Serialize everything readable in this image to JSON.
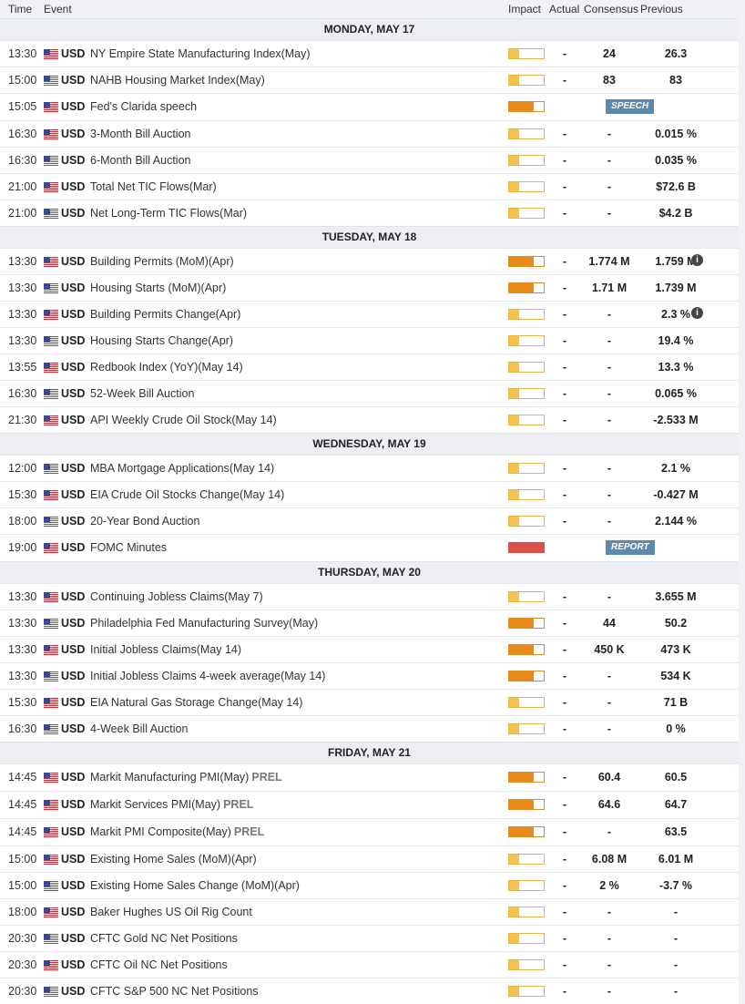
{
  "header": {
    "time_label": "Time",
    "event_label": "Event",
    "impact_label": "Impact",
    "actual_label": "Actual",
    "consensus_label": "Consensus",
    "previous_label": "Previous"
  },
  "colors": {
    "low_impact": "#f6c248",
    "medium_impact": "#e88a17",
    "high_impact": "#d9514a",
    "badge": "#5f88ad"
  },
  "days": [
    {
      "label": "MONDAY, MAY 17",
      "events": [
        {
          "time": "13:30",
          "currency": "USD",
          "event": "NY Empire State Manufacturing Index(May)",
          "impact": "low",
          "actual": "-",
          "consensus": "24",
          "previous": "26.3"
        },
        {
          "time": "15:00",
          "currency": "USD",
          "event": "NAHB Housing Market Index(May)",
          "impact": "low",
          "actual": "-",
          "consensus": "83",
          "previous": "83"
        },
        {
          "time": "15:05",
          "currency": "USD",
          "event": "Fed's Clarida speech",
          "impact": "medium",
          "badge": "SPEECH",
          "tall": true
        },
        {
          "time": "16:30",
          "currency": "USD",
          "event": "3-Month Bill Auction",
          "impact": "low",
          "actual": "-",
          "consensus": "-",
          "previous": "0.015 %"
        },
        {
          "time": "16:30",
          "currency": "USD",
          "event": "6-Month Bill Auction",
          "impact": "low",
          "actual": "-",
          "consensus": "-",
          "previous": "0.035 %"
        },
        {
          "time": "21:00",
          "currency": "USD",
          "event": "Total Net TIC Flows(Mar)",
          "impact": "low",
          "actual": "-",
          "consensus": "-",
          "previous": "$72.6 B"
        },
        {
          "time": "21:00",
          "currency": "USD",
          "event": "Net Long-Term TIC Flows(Mar)",
          "impact": "low",
          "actual": "-",
          "consensus": "-",
          "previous": "$4.2 B"
        }
      ]
    },
    {
      "label": "TUESDAY, MAY 18",
      "events": [
        {
          "time": "13:30",
          "currency": "USD",
          "event": "Building Permits (MoM)(Apr)",
          "impact": "medium",
          "actual": "-",
          "consensus": "1.774 M",
          "previous": "1.759 M",
          "info": true
        },
        {
          "time": "13:30",
          "currency": "USD",
          "event": "Housing Starts (MoM)(Apr)",
          "impact": "medium",
          "actual": "-",
          "consensus": "1.71 M",
          "previous": "1.739 M"
        },
        {
          "time": "13:30",
          "currency": "USD",
          "event": "Building Permits Change(Apr)",
          "impact": "low",
          "actual": "-",
          "consensus": "-",
          "previous": "2.3 %",
          "info": true
        },
        {
          "time": "13:30",
          "currency": "USD",
          "event": "Housing Starts Change(Apr)",
          "impact": "low",
          "actual": "-",
          "consensus": "-",
          "previous": "19.4 %"
        },
        {
          "time": "13:55",
          "currency": "USD",
          "event": "Redbook Index (YoY)(May 14)",
          "impact": "low",
          "actual": "-",
          "consensus": "-",
          "previous": "13.3 %"
        },
        {
          "time": "16:30",
          "currency": "USD",
          "event": "52-Week Bill Auction",
          "impact": "low",
          "actual": "-",
          "consensus": "-",
          "previous": "0.065 %"
        },
        {
          "time": "21:30",
          "currency": "USD",
          "event": "API Weekly Crude Oil Stock(May 14)",
          "impact": "low",
          "actual": "-",
          "consensus": "-",
          "previous": "-2.533 M"
        }
      ]
    },
    {
      "label": "WEDNESDAY, MAY 19",
      "events": [
        {
          "time": "12:00",
          "currency": "USD",
          "event": "MBA Mortgage Applications(May 14)",
          "impact": "low",
          "actual": "-",
          "consensus": "-",
          "previous": "2.1 %"
        },
        {
          "time": "15:30",
          "currency": "USD",
          "event": "EIA Crude Oil Stocks Change(May 14)",
          "impact": "low",
          "actual": "-",
          "consensus": "-",
          "previous": "-0.427 M"
        },
        {
          "time": "18:00",
          "currency": "USD",
          "event": "20-Year Bond Auction",
          "impact": "low",
          "actual": "-",
          "consensus": "-",
          "previous": "2.144 %"
        },
        {
          "time": "19:00",
          "currency": "USD",
          "event": "FOMC Minutes",
          "impact": "high",
          "badge": "REPORT",
          "tall": true
        }
      ]
    },
    {
      "label": "THURSDAY, MAY 20",
      "events": [
        {
          "time": "13:30",
          "currency": "USD",
          "event": "Continuing Jobless Claims(May 7)",
          "impact": "low",
          "actual": "-",
          "consensus": "-",
          "previous": "3.655 M"
        },
        {
          "time": "13:30",
          "currency": "USD",
          "event": "Philadelphia Fed Manufacturing Survey(May)",
          "impact": "medium",
          "actual": "-",
          "consensus": "44",
          "previous": "50.2"
        },
        {
          "time": "13:30",
          "currency": "USD",
          "event": "Initial Jobless Claims(May 14)",
          "impact": "medium",
          "actual": "-",
          "consensus": "450 K",
          "previous": "473 K"
        },
        {
          "time": "13:30",
          "currency": "USD",
          "event": "Initial Jobless Claims 4-week average(May 14)",
          "impact": "medium",
          "actual": "-",
          "consensus": "-",
          "previous": "534 K"
        },
        {
          "time": "15:30",
          "currency": "USD",
          "event": "EIA Natural Gas Storage Change(May 14)",
          "impact": "low",
          "actual": "-",
          "consensus": "-",
          "previous": "71 B"
        },
        {
          "time": "16:30",
          "currency": "USD",
          "event": "4-Week Bill Auction",
          "impact": "low",
          "actual": "-",
          "consensus": "-",
          "previous": "0 %"
        }
      ]
    },
    {
      "label": "FRIDAY, MAY 21",
      "events": [
        {
          "time": "14:45",
          "currency": "USD",
          "event": "Markit Manufacturing PMI(May)",
          "prel": "PREL",
          "impact": "medium",
          "actual": "-",
          "consensus": "60.4",
          "previous": "60.5",
          "tall": true
        },
        {
          "time": "14:45",
          "currency": "USD",
          "event": "Markit Services PMI(May)",
          "prel": "PREL",
          "impact": "medium",
          "actual": "-",
          "consensus": "64.6",
          "previous": "64.7",
          "tall": true
        },
        {
          "time": "14:45",
          "currency": "USD",
          "event": "Markit PMI Composite(May)",
          "prel": "PREL",
          "impact": "medium",
          "actual": "-",
          "consensus": "-",
          "previous": "63.5",
          "tall": true
        },
        {
          "time": "15:00",
          "currency": "USD",
          "event": "Existing Home Sales (MoM)(Apr)",
          "impact": "low",
          "actual": "-",
          "consensus": "6.08 M",
          "previous": "6.01 M"
        },
        {
          "time": "15:00",
          "currency": "USD",
          "event": "Existing Home Sales Change (MoM)(Apr)",
          "impact": "low",
          "actual": "-",
          "consensus": "2 %",
          "previous": "-3.7 %"
        },
        {
          "time": "18:00",
          "currency": "USD",
          "event": "Baker Hughes US Oil Rig Count",
          "impact": "low",
          "actual": "-",
          "consensus": "-",
          "previous": "-"
        },
        {
          "time": "20:30",
          "currency": "USD",
          "event": "CFTC Gold NC Net Positions",
          "impact": "low",
          "actual": "-",
          "consensus": "-",
          "previous": "-"
        },
        {
          "time": "20:30",
          "currency": "USD",
          "event": "CFTC Oil NC Net Positions",
          "impact": "low",
          "actual": "-",
          "consensus": "-",
          "previous": "-"
        },
        {
          "time": "20:30",
          "currency": "USD",
          "event": "CFTC S&P 500 NC Net Positions",
          "impact": "low",
          "actual": "-",
          "consensus": "-",
          "previous": "-"
        }
      ]
    }
  ]
}
